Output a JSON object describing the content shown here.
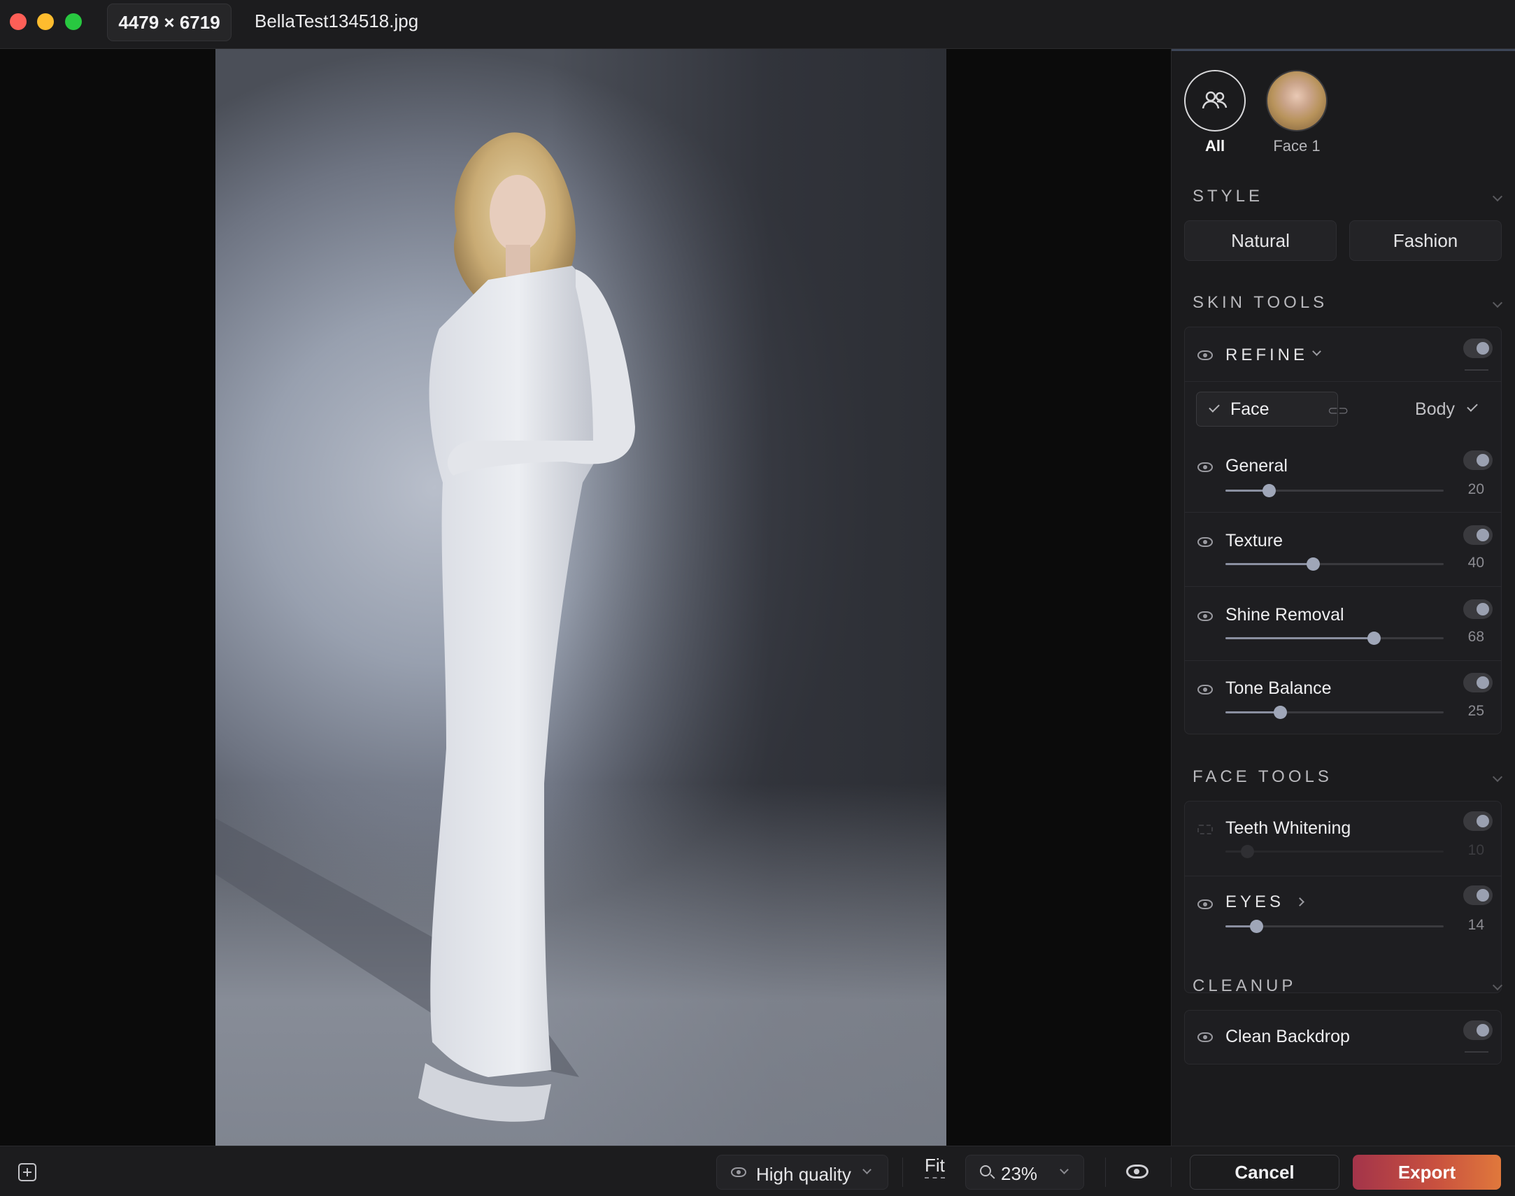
{
  "titlebar": {
    "dimensions": "4479 × 6719",
    "filename": "BellaTest134518.jpg"
  },
  "faces": {
    "all_label": "All",
    "face1_label": "Face 1"
  },
  "style": {
    "title": "STYLE",
    "natural": "Natural",
    "fashion": "Fashion"
  },
  "skin_tools": {
    "title": "SKIN TOOLS",
    "refine": "REFINE",
    "segment": {
      "face": "Face",
      "body": "Body"
    },
    "items": [
      {
        "label": "General",
        "value": "20",
        "level": 20
      },
      {
        "label": "Texture",
        "value": "40",
        "level": 40
      },
      {
        "label": "Shine Removal",
        "value": "68",
        "level": 68
      },
      {
        "label": "Tone Balance",
        "value": "25",
        "level": 25
      }
    ]
  },
  "face_tools": {
    "title": "FACE TOOLS",
    "teeth": {
      "label": "Teeth Whitening",
      "value": "10",
      "level": 10
    },
    "eyes": {
      "label": "EYES",
      "value": "14",
      "level": 14
    }
  },
  "cleanup": {
    "title": "CLEANUP",
    "clean_backdrop": "Clean Backdrop"
  },
  "bottombar": {
    "quality": "High quality",
    "fit": "Fit",
    "zoom": "23%",
    "cancel": "Cancel",
    "export": "Export"
  },
  "colors": {
    "accent_export_start": "#a3344a",
    "accent_export_end": "#e0783c",
    "panel_bg": "#1b1b1d"
  },
  "icons": [
    "people-icon",
    "eye-icon",
    "check-icon",
    "link-icon",
    "chevron-down-icon",
    "chevron-right-icon",
    "add-image-icon",
    "search-icon"
  ]
}
